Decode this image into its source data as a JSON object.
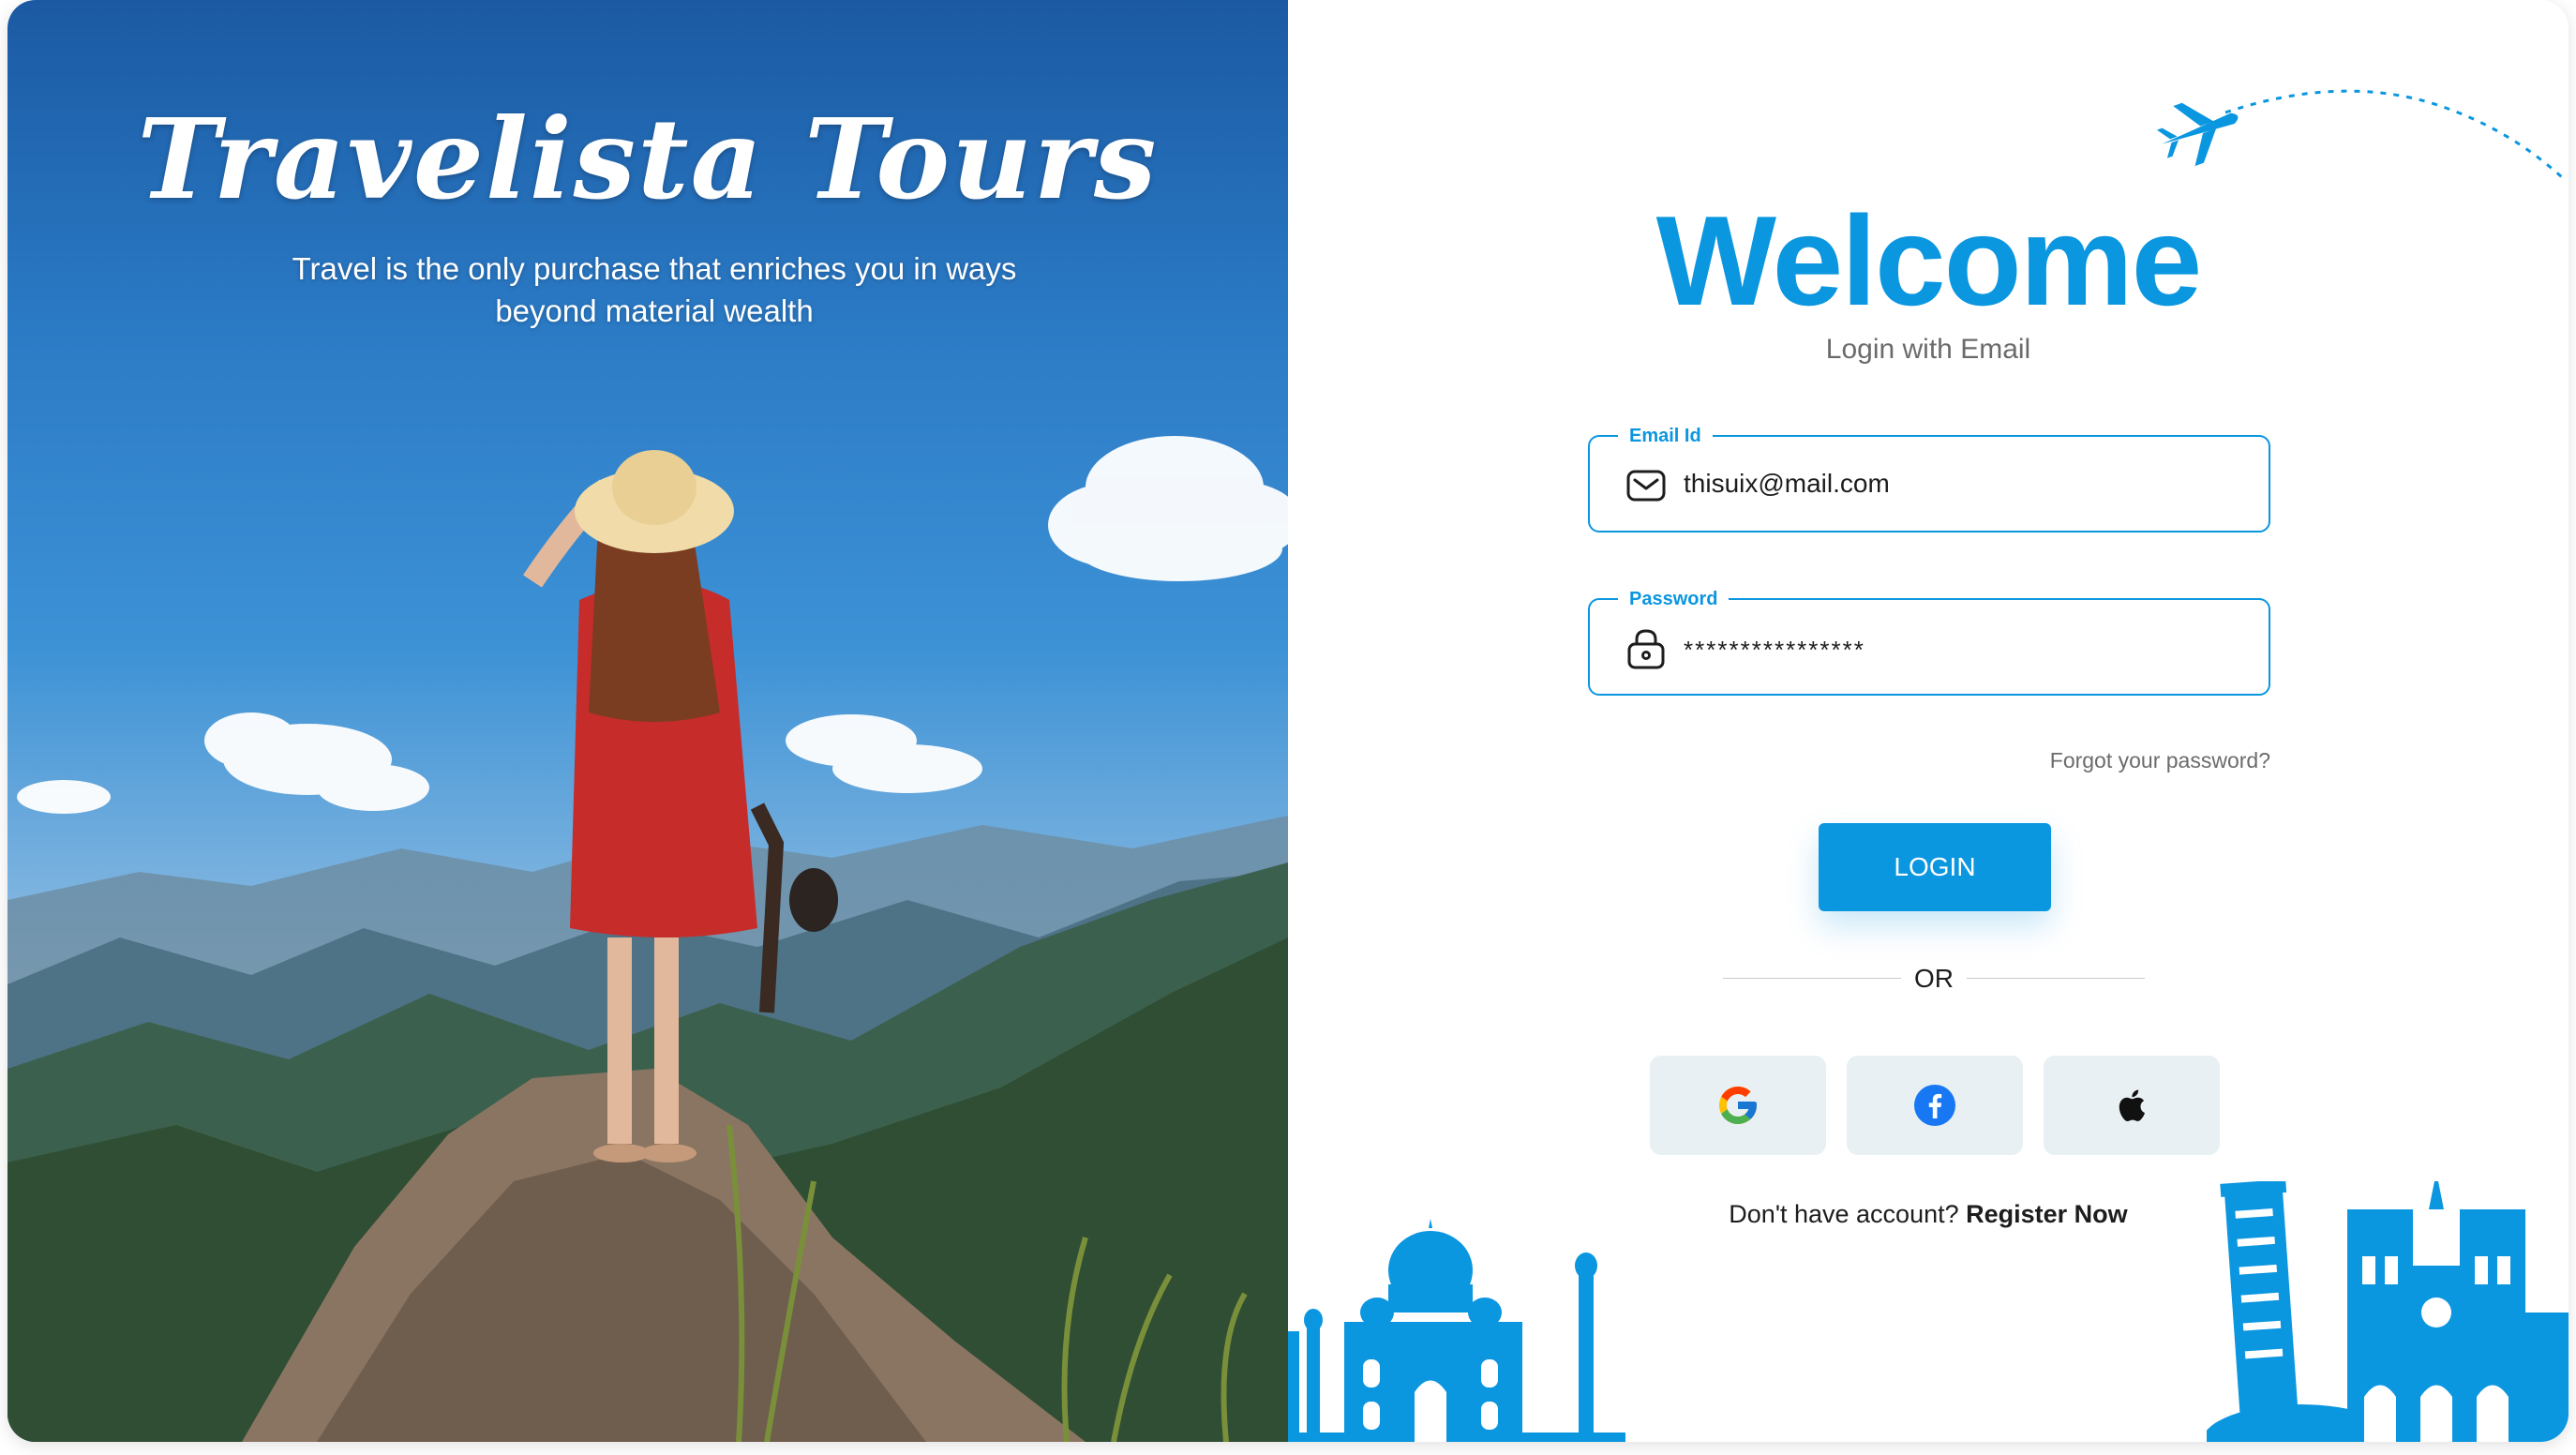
{
  "brand": {
    "name": "Travelista Tours",
    "tagline": "Travel is the only purchase that enriches you in ways beyond material wealth"
  },
  "login": {
    "heading": "Welcome",
    "subtitle": "Login with Email",
    "email_label": "Email Id",
    "email_value": "thisuix@mail.com",
    "password_label": "Password",
    "password_value": "****************",
    "forgot_label": "Forgot your password?",
    "login_button": "LOGIN",
    "or_label": "OR",
    "register_prompt": "Don't have account?",
    "register_link": "Register Now"
  },
  "social": [
    {
      "name": "google-icon"
    },
    {
      "name": "facebook-icon"
    },
    {
      "name": "apple-icon"
    }
  ],
  "colors": {
    "accent": "#0b96e0",
    "social_bg": "#e8f0f3",
    "text_muted": "#6b6b6b"
  }
}
